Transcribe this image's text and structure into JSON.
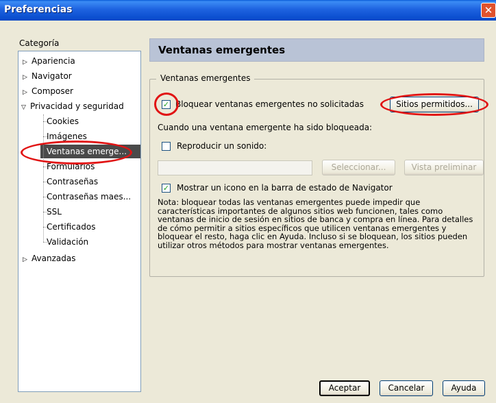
{
  "window": {
    "title": "Preferencias",
    "close_glyph": "✕"
  },
  "sidebar": {
    "label": "Categoría",
    "items": [
      {
        "label": "Apariencia",
        "arrow": "▷"
      },
      {
        "label": "Navigator",
        "arrow": "▷"
      },
      {
        "label": "Composer",
        "arrow": "▷"
      },
      {
        "label": "Privacidad y seguridad",
        "arrow": "▽"
      },
      {
        "label": "Cookies"
      },
      {
        "label": "Imágenes"
      },
      {
        "label": "Ventanas emerge...",
        "selected": true
      },
      {
        "label": "Formularios"
      },
      {
        "label": "Contraseñas"
      },
      {
        "label": "Contraseñas maes..."
      },
      {
        "label": "SSL"
      },
      {
        "label": "Certificados"
      },
      {
        "label": "Validación"
      },
      {
        "label": "Avanzadas",
        "arrow": "▷"
      }
    ]
  },
  "panel": {
    "title": "Ventanas emergentes",
    "group_label": "Ventanas emergentes",
    "block_checkbox": {
      "label": "Bloquear ventanas emergentes no solicitadas",
      "checked": true,
      "mark": "✓"
    },
    "allowed_sites_button": "Sitios permitidos...",
    "when_blocked_label": "Cuando una ventana emergente ha sido bloqueada:",
    "sound_checkbox": {
      "label": "Reproducir un sonido:",
      "checked": false
    },
    "sound_path_value": "",
    "select_button": "Seleccionar...",
    "preview_button": "Vista preliminar",
    "icon_checkbox": {
      "label": "Mostrar un icono en la barra de estado de Navigator",
      "checked": true,
      "mark": "✓"
    },
    "note": "Nota: bloquear todas las ventanas emergentes puede impedir que características importantes de algunos sitios web funcionen, tales como ventanas de inicio de sesión en sitios de banca y compra en línea. Para detalles de cómo permitir a sitios específicos que utilicen ventanas emergentes y bloquear el resto, haga clic en Ayuda. Incluso si se bloquean, los sitios pueden utilizar otros métodos para mostrar ventanas emergentes."
  },
  "footer": {
    "accept": "Aceptar",
    "cancel": "Cancelar",
    "help": "Ayuda"
  },
  "colors": {
    "highlight_ring": "#e11414",
    "selected_row": "#4a4a4a",
    "title_bar": "#0b4fd0"
  }
}
